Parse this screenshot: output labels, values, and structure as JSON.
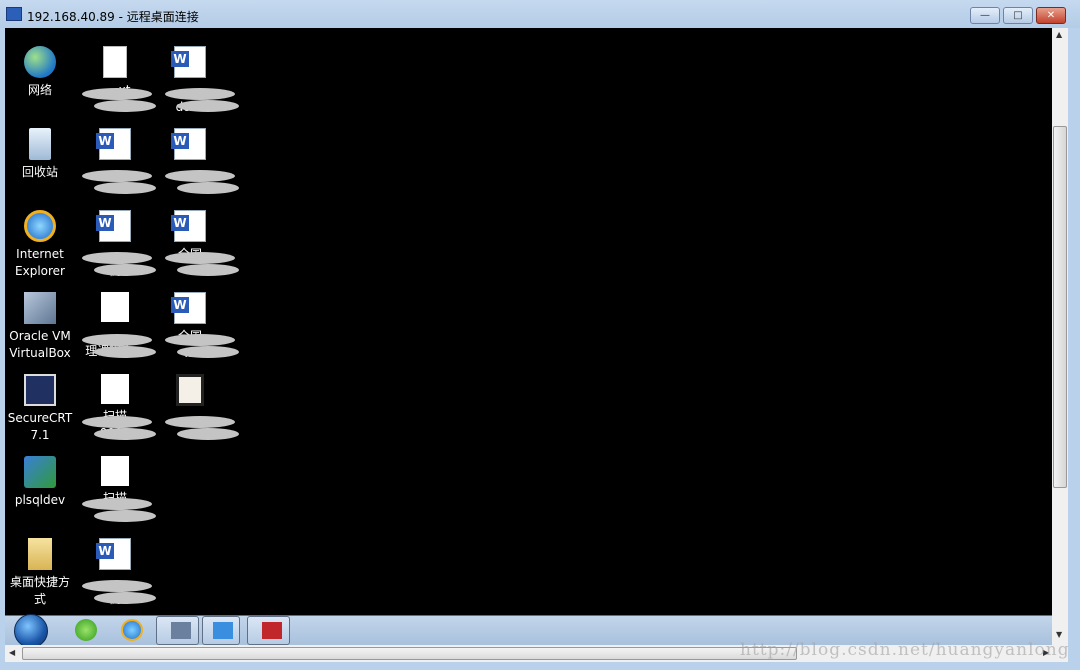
{
  "window": {
    "title": "192.168.40.89 - 远程桌面连接",
    "minimize": "—",
    "maximize": "□",
    "close": "✕"
  },
  "desktop": {
    "icons": [
      {
        "col": 0,
        "row": 0,
        "type": "network-icon",
        "label1": "网络",
        "label2": ""
      },
      {
        "col": 0,
        "row": 1,
        "type": "recycle-bin-icon",
        "label1": "回收站",
        "label2": ""
      },
      {
        "col": 0,
        "row": 2,
        "type": "internet-explorer-icon",
        "label1": "Internet",
        "label2": "Explorer"
      },
      {
        "col": 0,
        "row": 3,
        "type": "virtualbox-icon",
        "label1": "Oracle VM",
        "label2": "VirtualBox"
      },
      {
        "col": 0,
        "row": 4,
        "type": "securecrt-icon",
        "label1": "SecureCRT",
        "label2": "7.1"
      },
      {
        "col": 0,
        "row": 5,
        "type": "plsqldev-icon",
        "label1": "plsqldev",
        "label2": ""
      },
      {
        "col": 0,
        "row": 6,
        "type": "folder-icon",
        "label1": "桌面快捷方",
        "label2": "式"
      },
      {
        "col": 1,
        "row": 0,
        "type": "text-file-icon",
        "label1": "     xt",
        "label2": ""
      },
      {
        "col": 1,
        "row": 1,
        "type": "word-doc-icon",
        "label1": "",
        "label2": ""
      },
      {
        "col": 1,
        "row": 2,
        "type": "word-doc-icon",
        "label1": "",
        "label2": "例"
      },
      {
        "col": 1,
        "row": 3,
        "type": "scan-image-icon",
        "label1": "",
        "label2": "理课程大..."
      },
      {
        "col": 1,
        "row": 4,
        "type": "scan-image-icon",
        "label1": "扫描",
        "label2": "0002"
      },
      {
        "col": 1,
        "row": 5,
        "type": "scan-image-icon",
        "label1": "扫描",
        "label2": ""
      },
      {
        "col": 1,
        "row": 6,
        "type": "word-doc-icon",
        "label1": "",
        "label2": "例"
      },
      {
        "col": 2,
        "row": 0,
        "type": "word-doc-icon",
        "label1": "",
        "label2": "docx"
      },
      {
        "col": 2,
        "row": 1,
        "type": "word-doc-icon",
        "label1": "",
        "label2": ""
      },
      {
        "col": 2,
        "row": 2,
        "type": "word-doc-icon",
        "label1": "全国",
        "label2": ""
      },
      {
        "col": 2,
        "row": 3,
        "type": "word-doc-icon",
        "label1": "全国",
        "label2": "..."
      },
      {
        "col": 2,
        "row": 4,
        "type": "image-file-icon",
        "label1": "",
        "label2": ""
      }
    ]
  },
  "taskbar": {
    "items": [
      "start-button",
      "ie-green-icon",
      "internet-explorer-icon",
      "remote-desktop-app",
      "network-monitor-app",
      "toolbox-app"
    ]
  },
  "scroll": {
    "vertical_position": 0.16,
    "horizontal_position": 0
  },
  "watermark": "http://blog.csdn.net/huangyanlong"
}
